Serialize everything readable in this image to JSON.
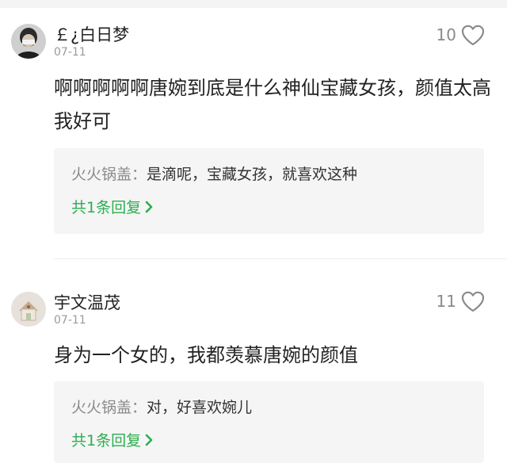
{
  "comments": [
    {
      "username": "￡¿白日梦",
      "date": "07-11",
      "likes": "10",
      "text": "啊啊啊啊啊唐婉到底是什么神仙宝藏女孩，颜值太高我好可",
      "reply": {
        "author": "火火锅盖",
        "separator": "：",
        "content": "是滴呢，宝藏女孩，就喜欢这种",
        "more_label": "共1条回复"
      }
    },
    {
      "username": "宇文温茂",
      "date": "07-11",
      "likes": "11",
      "text": "身为一个女的，我都羡慕唐婉的颜值",
      "reply": {
        "author": "火火锅盖",
        "separator": "：",
        "content": "对，好喜欢婉儿",
        "more_label": "共1条回复"
      }
    }
  ],
  "colors": {
    "accent_green": "#2aae4f",
    "muted_gray": "#8a8a8a",
    "reply_bg": "#f5f5f5"
  },
  "icons": {
    "like": "heart-icon",
    "expand": "chevron-right-icon"
  }
}
